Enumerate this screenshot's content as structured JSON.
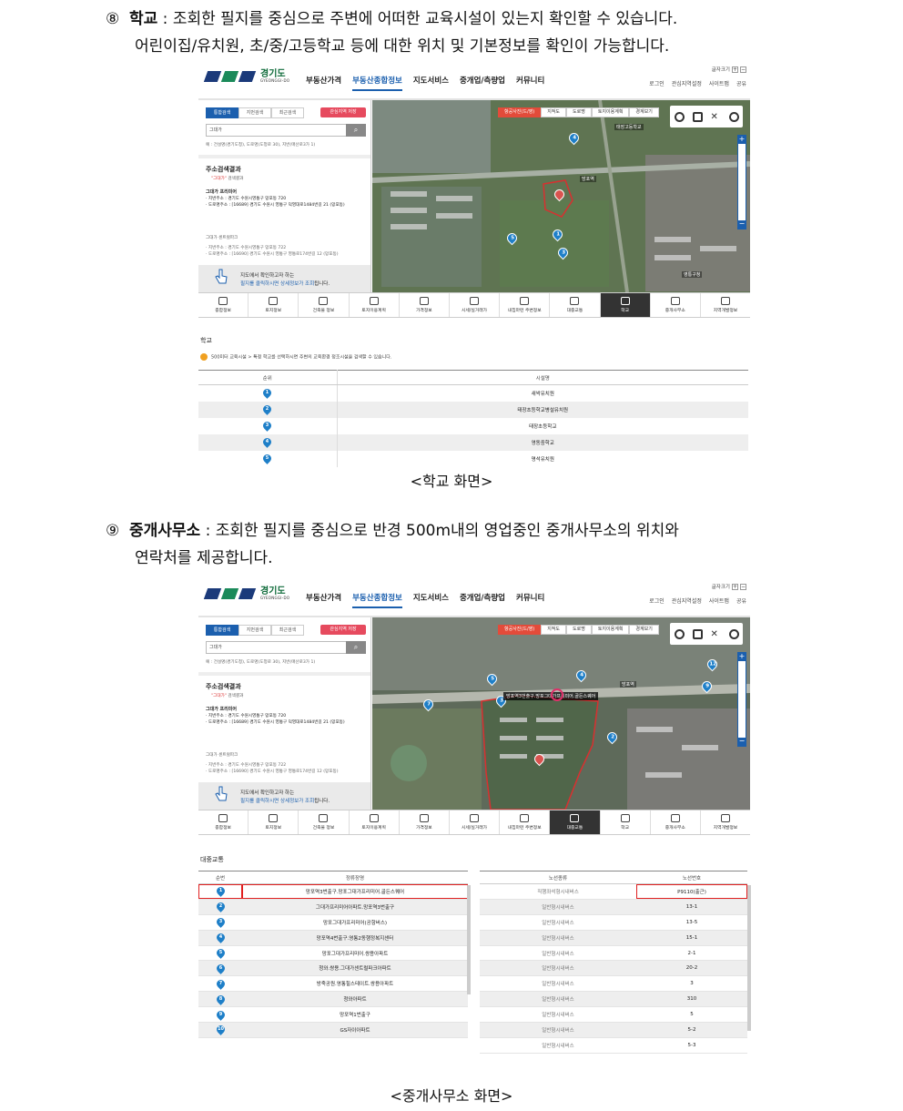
{
  "section8": {
    "number": "⑧",
    "title": "학교",
    "line1": " : 조회한 필지를 중심으로 주변에 어떠한 교육시설이 있는지 확인할 수 있습니다.",
    "line2": "어린이집/유치원, 초/중/고등학교 등에 대한 위치 및 기본정보를 확인이 가능합니다.",
    "caption": "<학교 화면>"
  },
  "section9": {
    "number": "⑨",
    "title": "중개사무소",
    "line1": " : 조회한 필지를 중심으로 반경 500m내의 영업중인 중개사무소의 위치와",
    "line2": "연락처를 제공합니다.",
    "caption": "<중개사무소 화면>"
  },
  "site": {
    "logo_text": "경기도",
    "logo_en": "GYEONGGI-DO",
    "nav": [
      "부동산가격",
      "부동산종합정보",
      "지도서비스",
      "중개업/측량업",
      "커뮤니티"
    ],
    "font_size_label": "글자크기",
    "util": [
      "로그인",
      "관심지역설정",
      "사이트맵",
      "공유"
    ],
    "tabs": [
      "통합검색",
      "지번검색",
      "최근검색"
    ],
    "fav_button": "관심지역 저장",
    "search_value": "그대가",
    "search_example": "예 : 건설명(경기도청), 도로명(도청로 30), 지번(매산로3가 1)",
    "result_title": "주소검색결과",
    "result_sub_quoted": "\"그대가\"",
    "result_sub": " 검색결과",
    "result1_name": "그대가 프리미어",
    "result1_jibun_label": "· 지번주소 :",
    "result1_jibun": "경기도 수원시영통구 망포동 720",
    "result1_road_label": "· 도로명주소 :",
    "result1_road": "[16689] 경기도 수원시 영통구 덕영대로1484번길 21 (망포동)",
    "result2_name": "그대가 센트럴파크",
    "result2_jibun": "· 지번주소 :    경기도 수원시영통구 망포동 722",
    "result2_road": "· 도로명주소 : [16690] 경기도 수원시 영통구 영통로174번길 12 (망포동)",
    "hint_line1": "지도에서 확인하고자 하는",
    "hint_line2a": "필지를 클릭하시면 상세정보가 조회",
    "hint_line2b": "됩니다.",
    "map_tabs": [
      "항공사진(드/영)",
      "지적도",
      "도로명",
      "토지이용계획",
      "경계보기"
    ],
    "categories": [
      "종합정보",
      "토지정보",
      "건축물 정보",
      "토지이용계획",
      "가격정보",
      "시세/실거래가",
      "내집마련 주변정보",
      "대중교통",
      "학교",
      "중개사무소",
      "지역개발정보"
    ]
  },
  "school_panel": {
    "title": "학교",
    "notice": "500미터 교육시설 > 특정 학교를 선택하시면 주변의 교육환경 정조시설을 검색할 수 있습니다.",
    "headers": [
      "순위",
      "시설명"
    ],
    "rows": [
      {
        "rank": "1",
        "name": "새싹유치원"
      },
      {
        "rank": "2",
        "name": "태장초등학교병설유치원"
      },
      {
        "rank": "3",
        "name": "태장초등학교"
      },
      {
        "rank": "4",
        "name": "영동중학교"
      },
      {
        "rank": "5",
        "name": "명석유치원"
      }
    ]
  },
  "transit_panel": {
    "title": "대중교통",
    "stop_headers": [
      "순번",
      "정류장명"
    ],
    "stops": [
      {
        "no": "1",
        "name": "망포역3번출구.망포그대가프리미어.골든스퀘어"
      },
      {
        "no": "2",
        "name": "그대가프리미어아파트.망포역3번출구"
      },
      {
        "no": "3",
        "name": "망포그대가프리미어(공항버스)"
      },
      {
        "no": "4",
        "name": "망포역4번출구.영통2동행정복지센터"
      },
      {
        "no": "5",
        "name": "망포그대가프리미어.쌍용아파트"
      },
      {
        "no": "6",
        "name": "청와.쌍용.그대가센트럴파크아파트"
      },
      {
        "no": "7",
        "name": "방죽공원.영통힐스테이트.쌍용아파트"
      },
      {
        "no": "8",
        "name": "청와아파트"
      },
      {
        "no": "9",
        "name": "망포역1번출구"
      },
      {
        "no": "10",
        "name": "GS자이아파트"
      }
    ],
    "route_headers": [
      "노선종류",
      "노선번호"
    ],
    "routes": [
      {
        "type": "직행좌석형시내버스",
        "number": "P9110(출근)"
      },
      {
        "type": "일반형시내버스",
        "number": "13-1"
      },
      {
        "type": "일반형시내버스",
        "number": "13-5"
      },
      {
        "type": "일반형시내버스",
        "number": "15-1"
      },
      {
        "type": "일반형시내버스",
        "number": "2-1"
      },
      {
        "type": "일반형시내버스",
        "number": "20-2"
      },
      {
        "type": "일반형시내버스",
        "number": "3"
      },
      {
        "type": "일반형시내버스",
        "number": "310"
      },
      {
        "type": "일반형시내버스",
        "number": "5"
      },
      {
        "type": "일반형시내버스",
        "number": "5-2"
      },
      {
        "type": "일반형시내버스",
        "number": "5-3"
      }
    ]
  },
  "map1_labels": [
    "태장고등학교",
    "망포역",
    "영통구청"
  ],
  "map2_labels": [
    "망포역"
  ],
  "map2_overlay": "망포역3번출구.망포그대가프리미어.골든스퀘어",
  "colors": {
    "brand_blue": "#1b5fae",
    "brand_green": "#0f6b3a",
    "active_red": "#e34b3a",
    "pin_blue": "#1e7fc8",
    "highlight_red": "#e02020"
  }
}
